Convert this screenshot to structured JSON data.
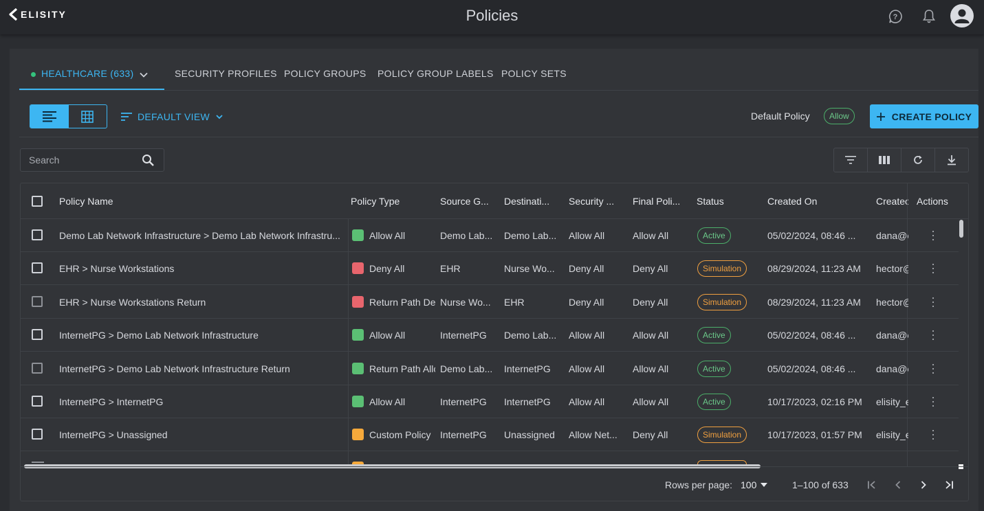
{
  "app": {
    "brand": "ELISITY",
    "title": "Policies"
  },
  "icons": {
    "help": "help-circle-icon",
    "notifications": "bell-icon",
    "avatar": "user-avatar-icon"
  },
  "tabs": [
    {
      "label": "HEALTHCARE (633)",
      "active": true,
      "status_color": "#34c27d"
    },
    {
      "label": "SECURITY PROFILES",
      "active": false
    },
    {
      "label": "POLICY GROUPS",
      "active": false
    },
    {
      "label": "POLICY GROUP LABELS",
      "active": false
    },
    {
      "label": "POLICY SETS",
      "active": false
    }
  ],
  "toolbar": {
    "view_label": "DEFAULT VIEW",
    "default_policy_label": "Default Policy",
    "default_policy_value": "Allow",
    "create_label": "CREATE POLICY"
  },
  "search": {
    "placeholder": "Search",
    "value": ""
  },
  "colors": {
    "accent": "#3db6f2",
    "active_status": "#6cc98a",
    "simulation_status": "#f0a040",
    "allow_all": "#5bbf74",
    "deny_all": "#e8656d",
    "custom_policy": "#f6a93b"
  },
  "table": {
    "columns": [
      "Policy Name",
      "Policy Type",
      "Source G...",
      "Destinati...",
      "Security ...",
      "Final Poli...",
      "Status",
      "Created On",
      "Createc",
      "Actions"
    ],
    "rows": [
      {
        "name": "Demo Lab Network Infrastructure > Demo Lab Network Infrastru...",
        "type": "Allow All",
        "type_color": "#5bbf74",
        "source": "Demo Lab...",
        "destination": "Demo Lab...",
        "security": "Allow All",
        "final": "Allow All",
        "status": "Active",
        "created_on": "05/02/2024, 08:46 ...",
        "created_by": "dana@e"
      },
      {
        "name": "EHR > Nurse Workstations",
        "type": "Deny All",
        "type_color": "#e8656d",
        "source": "EHR",
        "destination": "Nurse Wo...",
        "security": "Deny All",
        "final": "Deny All",
        "status": "Simulation",
        "created_on": "08/29/2024, 11:23 AM",
        "created_by": "hector@"
      },
      {
        "name": "EHR > Nurse Workstations Return",
        "type": "Return Path Der",
        "type_color": "#e8656d",
        "source": "Nurse Wo...",
        "destination": "EHR",
        "security": "Deny All",
        "final": "Deny All",
        "status": "Simulation",
        "created_on": "08/29/2024, 11:23 AM",
        "created_by": "hector@"
      },
      {
        "name": "InternetPG > Demo Lab Network Infrastructure",
        "type": "Allow All",
        "type_color": "#5bbf74",
        "source": "InternetPG",
        "destination": "Demo Lab...",
        "security": "Allow All",
        "final": "Allow All",
        "status": "Active",
        "created_on": "05/02/2024, 08:46 ...",
        "created_by": "dana@e"
      },
      {
        "name": "InternetPG > Demo Lab Network Infrastructure Return",
        "type": "Return Path Allc",
        "type_color": "#5bbf74",
        "source": "Demo Lab...",
        "destination": "InternetPG",
        "security": "Allow All",
        "final": "Allow All",
        "status": "Active",
        "created_on": "05/02/2024, 08:46 ...",
        "created_by": "dana@e"
      },
      {
        "name": "InternetPG > InternetPG",
        "type": "Allow All",
        "type_color": "#5bbf74",
        "source": "InternetPG",
        "destination": "InternetPG",
        "security": "Allow All",
        "final": "Allow All",
        "status": "Active",
        "created_on": "10/17/2023, 02:16 PM",
        "created_by": "elisity_e"
      },
      {
        "name": "InternetPG > Unassigned",
        "type": "Custom Policy",
        "type_color": "#f6a93b",
        "source": "InternetPG",
        "destination": "Unassigned",
        "security": "Allow Net...",
        "final": "Deny All",
        "status": "Simulation",
        "created_on": "10/17/2023, 01:57 PM",
        "created_by": "elisity_e"
      }
    ]
  },
  "pagination": {
    "rows_per_page_label": "Rows per page:",
    "rows_per_page_value": "100",
    "range": "1–100 of 633"
  }
}
